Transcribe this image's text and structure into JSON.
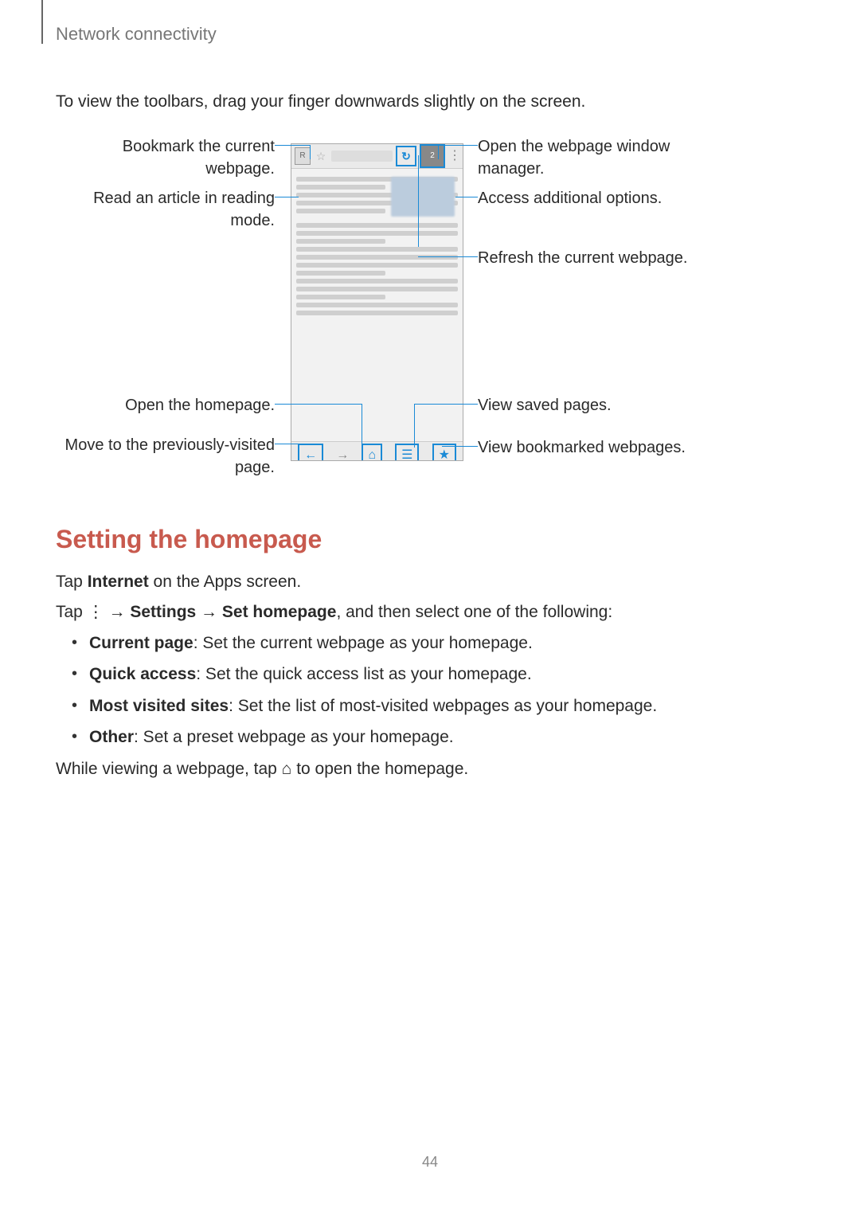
{
  "header": "Network connectivity",
  "intro": "To view the toolbars, drag your finger downwards slightly on the screen.",
  "callouts": {
    "bookmark": "Bookmark the current webpage.",
    "reading": "Read an article in reading mode.",
    "homepage": "Open the homepage.",
    "back": "Move to the previously-visited page.",
    "wins": "Open the webpage window manager.",
    "options": "Access additional options.",
    "refresh": "Refresh the current webpage.",
    "saved": "View saved pages.",
    "bookmarks": "View bookmarked webpages."
  },
  "section_title": "Setting the homepage",
  "body": {
    "p1a": "Tap ",
    "p1b": "Internet",
    "p1c": " on the Apps screen.",
    "p2a": "Tap ",
    "p2_icon": "⋮",
    "p2b": " → ",
    "p2c": "Settings",
    "p2d": " → ",
    "p2e": "Set homepage",
    "p2f": ", and then select one of the following:",
    "p3a": "While viewing a webpage, tap ",
    "p3_icon": "⌂",
    "p3b": " to open the homepage."
  },
  "options": [
    {
      "title": "Current page",
      "desc": ": Set the current webpage as your homepage."
    },
    {
      "title": "Quick access",
      "desc": ": Set the quick access list as your homepage."
    },
    {
      "title": "Most visited sites",
      "desc": ": Set the list of most-visited webpages as your homepage."
    },
    {
      "title": "Other",
      "desc": ": Set a preset webpage as your homepage."
    }
  ],
  "page_number": "44"
}
